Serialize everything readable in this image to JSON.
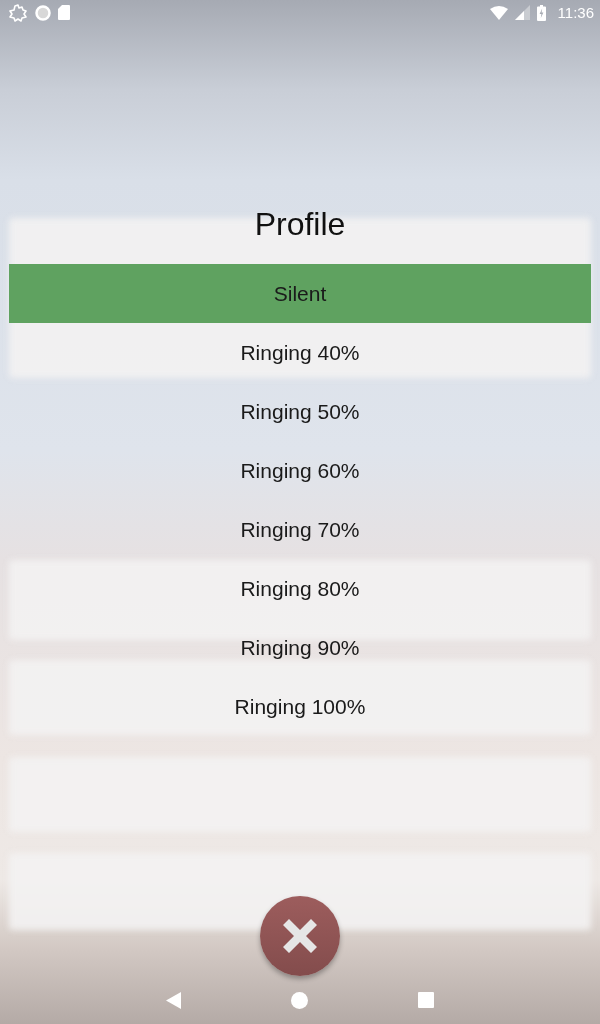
{
  "status_bar": {
    "time": "11:36"
  },
  "dialog": {
    "title": "Profile",
    "options": [
      {
        "label": "Silent",
        "selected": true
      },
      {
        "label": "Ringing 40%",
        "selected": false
      },
      {
        "label": "Ringing 50%",
        "selected": false
      },
      {
        "label": "Ringing 60%",
        "selected": false
      },
      {
        "label": "Ringing 70%",
        "selected": false
      },
      {
        "label": "Ringing 80%",
        "selected": false
      },
      {
        "label": "Ringing 90%",
        "selected": false
      },
      {
        "label": "Ringing 100%",
        "selected": false
      }
    ]
  }
}
